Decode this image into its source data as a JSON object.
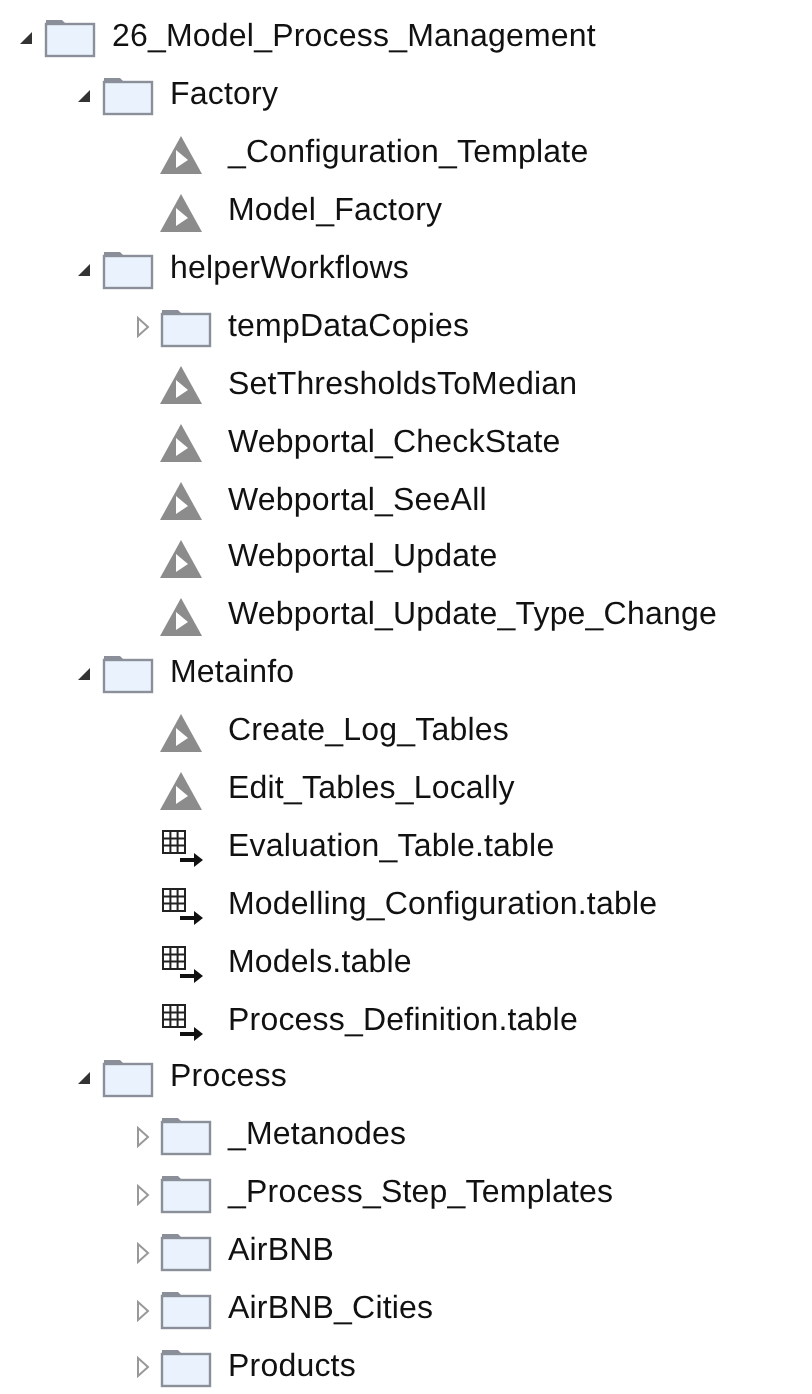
{
  "tree": [
    {
      "label": "26_Model_Process_Management",
      "kind": "folder",
      "expanded": true,
      "children": [
        {
          "label": "Factory",
          "kind": "folder",
          "expanded": true,
          "children": [
            {
              "label": "_Configuration_Template",
              "kind": "workflow"
            },
            {
              "label": "Model_Factory",
              "kind": "workflow"
            }
          ]
        },
        {
          "label": "helperWorkflows",
          "kind": "folder",
          "expanded": true,
          "children": [
            {
              "label": "tempDataCopies",
              "kind": "folder",
              "expanded": false
            },
            {
              "label": "SetThresholdsToMedian",
              "kind": "workflow"
            },
            {
              "label": "Webportal_CheckState",
              "kind": "workflow"
            },
            {
              "label": "Webportal_SeeAll",
              "kind": "workflow"
            },
            {
              "label": "Webportal_Update",
              "kind": "workflow"
            },
            {
              "label": "Webportal_Update_Type_Change",
              "kind": "workflow"
            }
          ]
        },
        {
          "label": "Metainfo",
          "kind": "folder",
          "expanded": true,
          "children": [
            {
              "label": "Create_Log_Tables",
              "kind": "workflow"
            },
            {
              "label": "Edit_Tables_Locally",
              "kind": "workflow"
            },
            {
              "label": "Evaluation_Table.table",
              "kind": "table"
            },
            {
              "label": "Modelling_Configuration.table",
              "kind": "table"
            },
            {
              "label": "Models.table",
              "kind": "table"
            },
            {
              "label": "Process_Definition.table",
              "kind": "table"
            }
          ]
        },
        {
          "label": "Process",
          "kind": "folder",
          "expanded": true,
          "children": [
            {
              "label": "_Metanodes",
              "kind": "folder",
              "expanded": false
            },
            {
              "label": "_Process_Step_Templates",
              "kind": "folder",
              "expanded": false
            },
            {
              "label": "AirBNB",
              "kind": "folder",
              "expanded": false
            },
            {
              "label": "AirBNB_Cities",
              "kind": "folder",
              "expanded": false
            },
            {
              "label": "Products",
              "kind": "folder",
              "expanded": false
            }
          ]
        }
      ]
    }
  ]
}
